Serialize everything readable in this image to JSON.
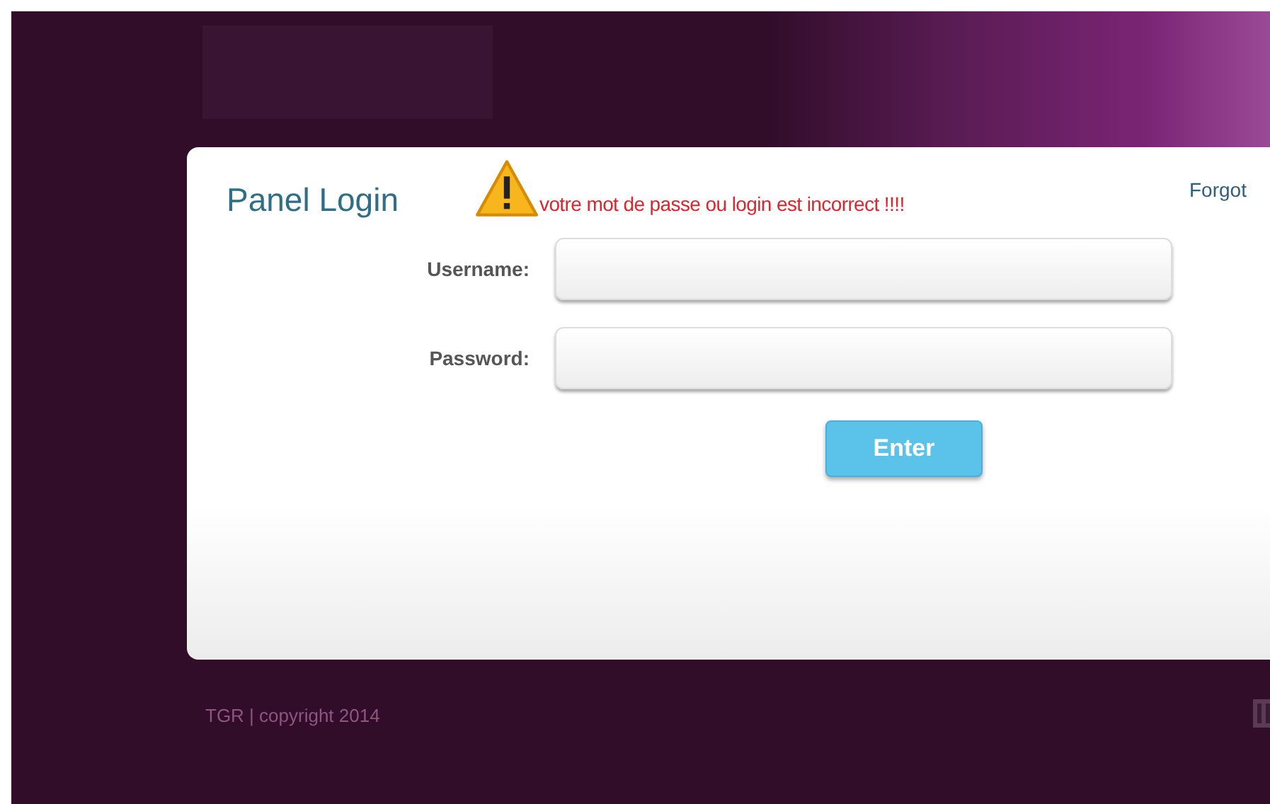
{
  "login_panel": {
    "title": "Panel Login",
    "error_message": "votre mot de passe ou login est incorrect !!!!",
    "forgot_link": "Forgot",
    "fields": [
      {
        "label": "Username:"
      },
      {
        "label": "Password:"
      }
    ],
    "submit_button": "Enter"
  },
  "footer": {
    "text": "TGR | copyright 2014"
  }
}
